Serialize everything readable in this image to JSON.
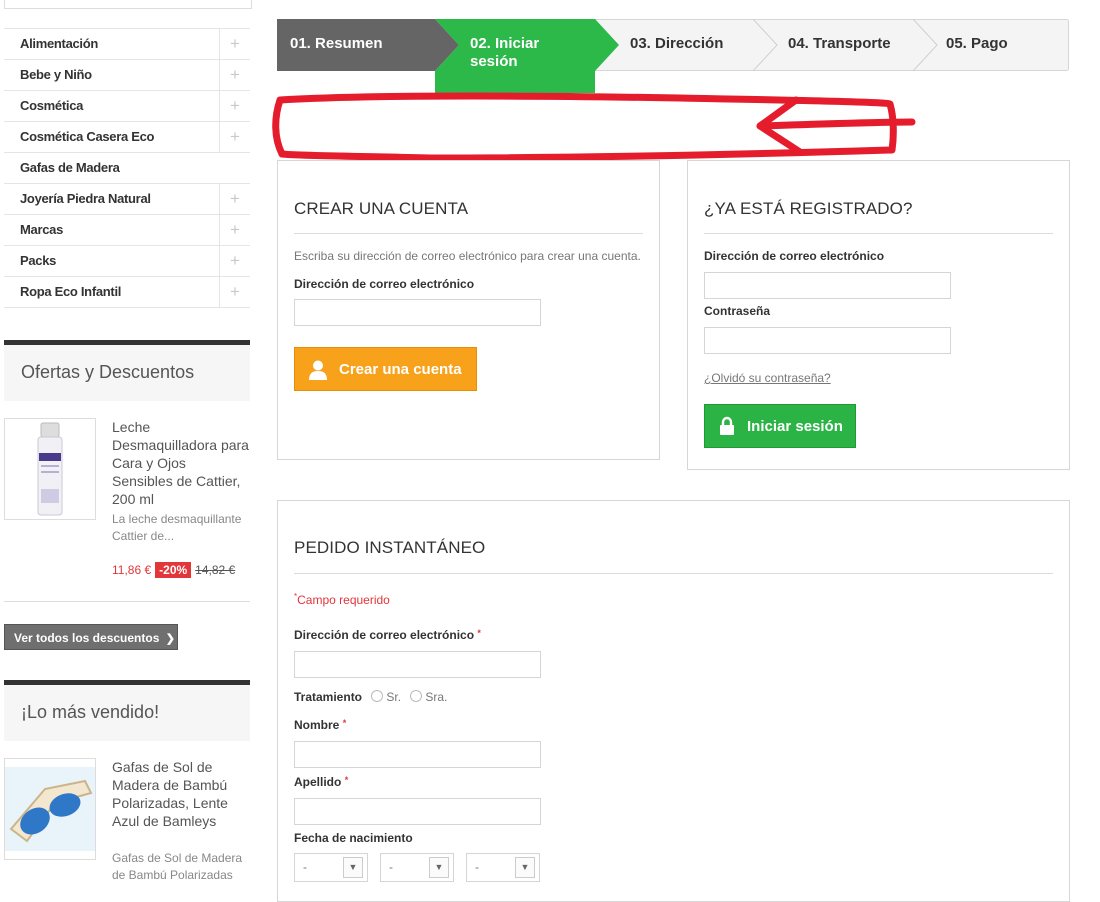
{
  "sidebar": {
    "categories": [
      {
        "label": "Alimentación",
        "toggle": "+"
      },
      {
        "label": "Bebe y Niño",
        "toggle": "+"
      },
      {
        "label": "Cosmética",
        "toggle": "+"
      },
      {
        "label": "Cosmética Casera Eco",
        "toggle": "+"
      },
      {
        "label": "Gafas de Madera",
        "toggle": ""
      },
      {
        "label": "Joyería Piedra Natural",
        "toggle": "+"
      },
      {
        "label": "Marcas",
        "toggle": "+"
      },
      {
        "label": "Packs",
        "toggle": "+"
      },
      {
        "label": "Ropa Eco Infantil",
        "toggle": "+"
      }
    ],
    "offers": {
      "title": "Ofertas y Descuentos",
      "product_name": "Leche Desmaquilladora para Cara y Ojos Sensibles de Cattier, 200 ml",
      "product_desc": "La leche desmaquillante Cattier de...",
      "price": "11,86 €",
      "discount": "-20%",
      "old_price": "14,82 €",
      "all_label": "Ver todos los descuentos"
    },
    "bestsellers": {
      "title": "¡Lo más vendido!",
      "product_name": "Gafas de Sol de Madera de Bambú Polarizadas, Lente Azul de Bamleys",
      "product_desc": "Gafas de Sol de Madera de Bambú Polarizadas"
    }
  },
  "steps": [
    {
      "label": "01. Resumen",
      "state": "done"
    },
    {
      "label": "02. Iniciar sesión",
      "state": "current"
    },
    {
      "label": "03. Dirección",
      "state": "todo"
    },
    {
      "label": "04. Transporte",
      "state": "todo"
    },
    {
      "label": "05. Pago",
      "state": "todo"
    }
  ],
  "create_account": {
    "title": "CREAR UNA CUENTA",
    "intro": "Escriba su dirección de correo electrónico para crear una cuenta.",
    "email_label": "Dirección de correo electrónico",
    "email_value": "",
    "button": "Crear una cuenta"
  },
  "login": {
    "title": "¿YA ESTÁ REGISTRADO?",
    "email_label": "Dirección de correo electrónico",
    "email_value": "",
    "password_label": "Contraseña",
    "password_value": "",
    "forgot": "¿Olvidó su contraseña?",
    "button": "Iniciar sesión"
  },
  "quick_order": {
    "title": "PEDIDO INSTANTÁNEO",
    "required_note": "Campo requerido",
    "required_mark": "*",
    "email_label": "Dirección de correo electrónico",
    "title_label": "Tratamiento",
    "title_options": [
      "Sr.",
      "Sra."
    ],
    "first_name_label": "Nombre",
    "last_name_label": "Apellido",
    "birth_label": "Fecha de nacimiento",
    "birth_selects": [
      "-",
      "-",
      "-"
    ]
  },
  "colors": {
    "step_done": "#656565",
    "step_current": "#2db84a",
    "create_button": "#f7a21a",
    "login_button": "#2bb445",
    "annotation": "#e51c2b",
    "discount": "#e3363b"
  }
}
